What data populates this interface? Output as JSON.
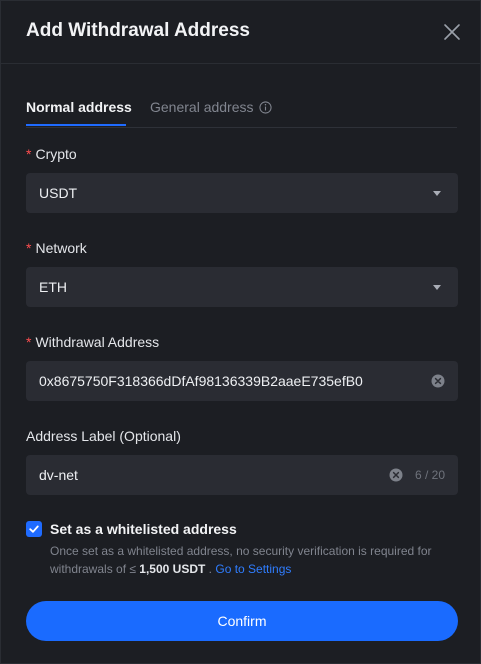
{
  "dialog": {
    "title": "Add Withdrawal Address"
  },
  "tabs": [
    {
      "label": "Normal address",
      "active": true
    },
    {
      "label": "General address",
      "active": false
    }
  ],
  "form": {
    "crypto": {
      "required_mark": "*",
      "label": "Crypto",
      "value": "USDT"
    },
    "network": {
      "required_mark": "*",
      "label": "Network",
      "value": "ETH"
    },
    "address": {
      "required_mark": "*",
      "label": "Withdrawal Address",
      "value": "0x8675750F318366dDfAf98136339B2aaeE735efB0"
    },
    "address_label": {
      "label": "Address Label (Optional)",
      "value": "dv-net",
      "counter": "6 / 20"
    }
  },
  "whitelist": {
    "checked": true,
    "label": "Set as a whitelisted address",
    "hint_prefix": "Once set as a whitelisted address, no security verification is required for withdrawals of ≤",
    "hint_amount": "1,500 USDT",
    "hint_sep": ".",
    "settings_link": "Go to Settings"
  },
  "actions": {
    "confirm_label": "Confirm"
  },
  "colors": {
    "accent": "#1a6bff",
    "required": "#ff4d4f",
    "background": "#1c1e23",
    "field_background": "#2a2c33"
  },
  "icons": {
    "close": "close-icon",
    "info": "info-icon",
    "dropdown": "chevron-down-icon",
    "clear": "clear-icon",
    "check": "check-icon"
  }
}
